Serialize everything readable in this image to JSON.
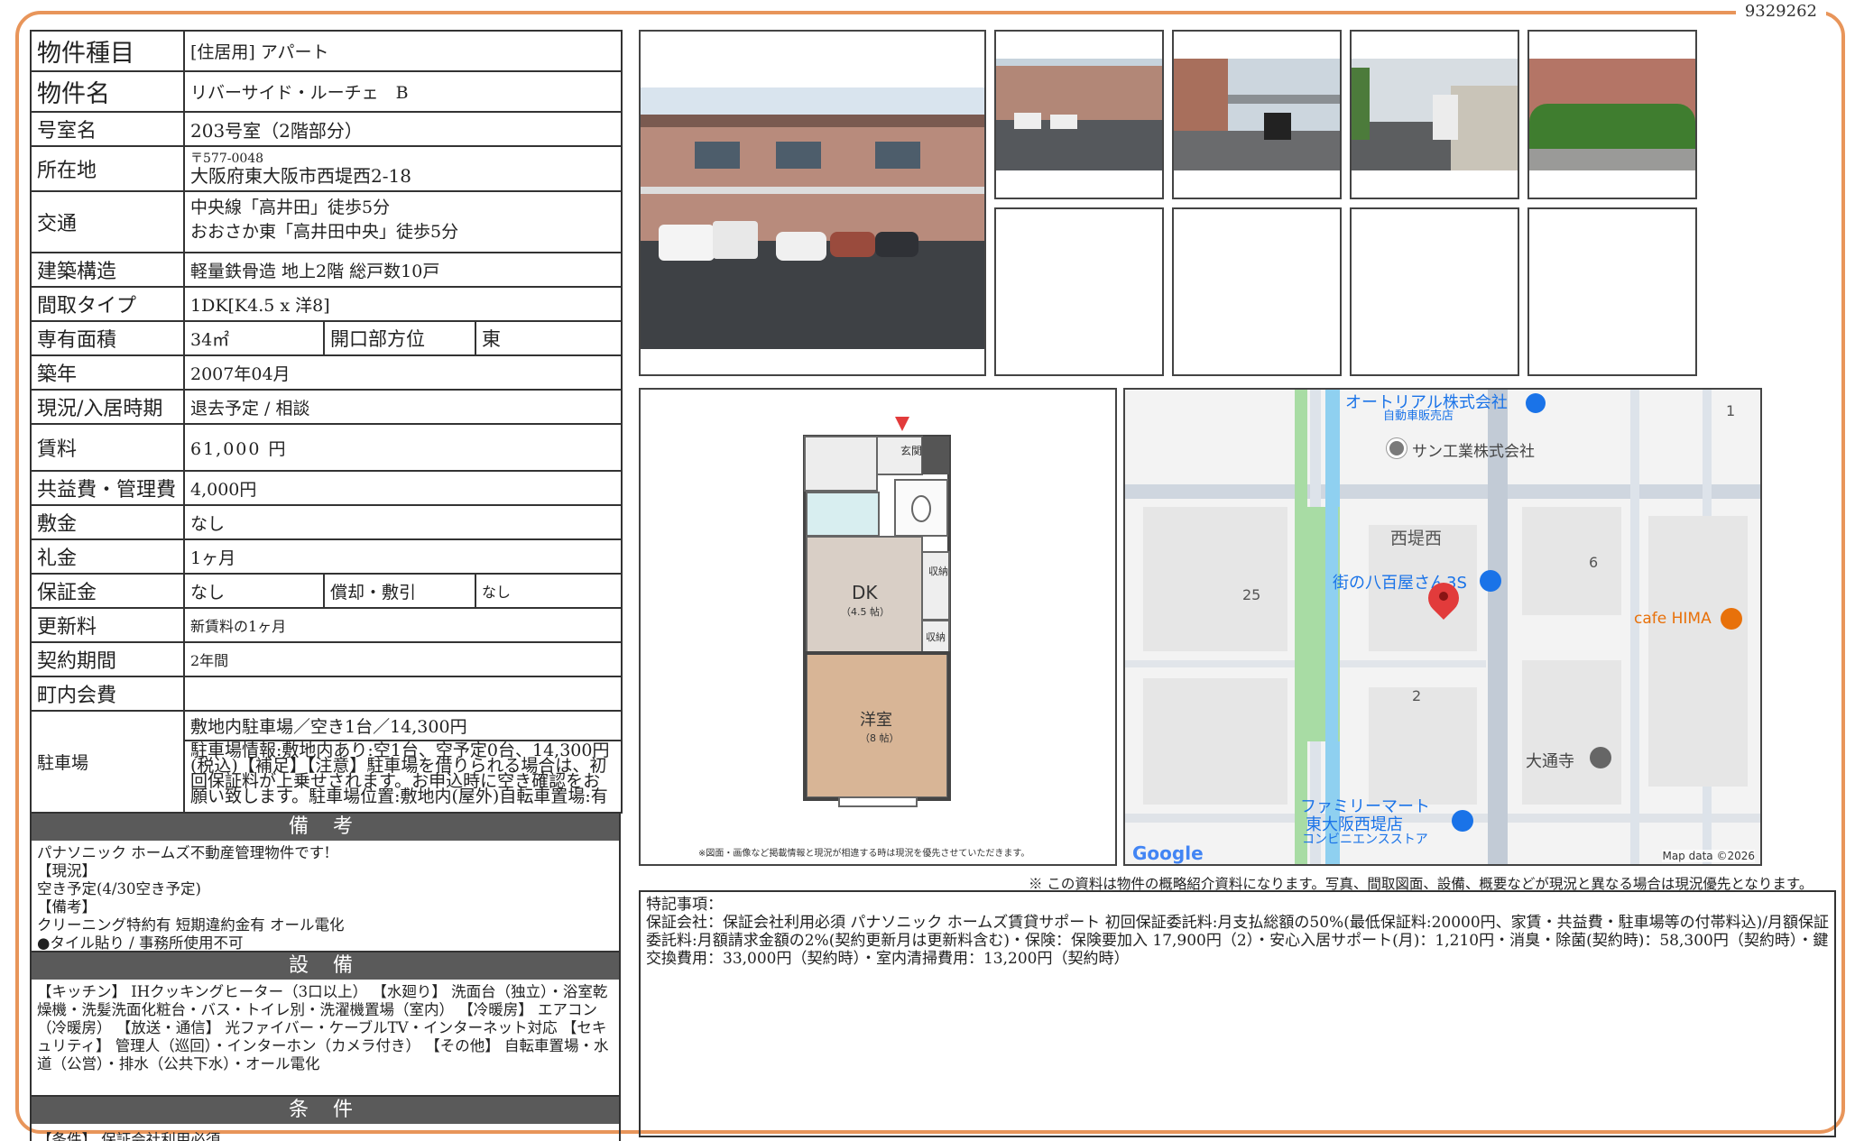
{
  "doc_id": "9329262",
  "spec": {
    "type_label": "物件種目",
    "type_value": "[住居用]  アパート",
    "name_label": "物件名",
    "name_value": "リバーサイド・ルーチェ　B",
    "room_label": "号室名",
    "room_value": "203号室（2階部分）",
    "address_label": "所在地",
    "postal": "〒577-0048",
    "address": "大阪府東大阪市西堤西2-18",
    "transport_label": "交通",
    "transport_1": "中央線「高井田」徒歩5分",
    "transport_2": "おおさか東「高井田中央」徒歩5分",
    "structure_label": "建築構造",
    "structure_value": "軽量鉄骨造  地上2階  総戸数10戸",
    "layout_label": "間取タイプ",
    "layout_value": "1DK[K4.5 x 洋8]",
    "area_label": "専有面積",
    "area_value": "34㎡",
    "opening_label": "開口部方位",
    "opening_value": "東",
    "built_label": "築年",
    "built_value": "2007年04月",
    "status_label": "現況/入居時期",
    "status_value": "退去予定  /  相談",
    "rent_label": "賃料",
    "rent_value": "61,000 円",
    "fee_label": "共益費・管理費",
    "fee_value": "4,000円",
    "deposit_label": "敷金",
    "deposit_value": "なし",
    "key_label": "礼金",
    "key_value": "1ヶ月",
    "guarantee_label": "保証金",
    "guarantee_value": "なし",
    "amort_label": "償却・敷引",
    "amort_value": "なし",
    "renewal_label": "更新料",
    "renewal_value": "新賃料の1ヶ月",
    "contract_label": "契約期間",
    "contract_value": "2年間",
    "town_label": "町内会費",
    "town_value": "",
    "parking_label": "駐車場",
    "parking_value": "敷地内駐車場／空き1台／14,300円",
    "parking_detail": "駐車場情報:敷地内あり:空1台、空予定0台、14,300円(税込)【補足】【注意】駐車場を借りられる場合は、初回保証料が上乗せされます。お申込時に空き確認をお願い致します。駐車場位置:敷地内(屋外)自転車置場:有"
  },
  "remarks": {
    "title": "備 考",
    "lines": [
      "パナソニック ホームズ不動産管理物件です!",
      "【現況】",
      "空き予定(4/30空き予定)",
      "【備考】",
      "クリーニング特約有  短期違約金有  オール電化",
      "●タイル貼り  /  事務所使用不可"
    ]
  },
  "equipment": {
    "title": "設 備",
    "text": "【キッチン】 IHクッキングヒーター（3口以上） 【水廻り】 洗面台（独立）・浴室乾燥機・洗髪洗面化粧台・バス・トイレ別・洗濯機置場（室内） 【冷暖房】 エアコン（冷暖房） 【放送・通信】 光ファイバー・ケーブルTV・インターネット対応 【セキュリティ】 管理人（巡回）・インターホン（カメラ付き） 【その他】 自転車置場・水道（公営）・排水（公共下水）・オール電化"
  },
  "conditions": {
    "title": "条 件",
    "text": "【条件】 保証会社利用必須"
  },
  "floorplan": {
    "genkan": "玄関",
    "dk": "DK",
    "dk_size": "（4.5 帖）",
    "storage": "収納",
    "storage2": "収納",
    "youshitsu": "洋室",
    "yous_size": "（8 帖）",
    "note": "※図面・画像など掲載情報と現況が相違する時は現況を優先させていただきます。"
  },
  "map": {
    "labels": {
      "autorial": "オートリアル株式会社",
      "autorial_sub": "自動車販売店",
      "san": "サン工業株式会社",
      "nishi": "西堤西",
      "yaoya": "街の八百屋さん3S",
      "cafe": "cafe HIMA",
      "daitsuji": "大通寺",
      "famima": "ファミリーマート",
      "famima2": "東大阪西堤店",
      "famima3": "コンビニエンスストア",
      "n1": "1",
      "n25": "25",
      "n6": "6",
      "n2": "2"
    },
    "google": "Google",
    "mapdata": "Map data ©2026"
  },
  "disclaimer": "※ この資料は物件の概略紹介資料になります。写真、間取図面、設備、概要などが現況と異なる場合は現況優先となります。",
  "special": {
    "title": "特記事項：",
    "text": "保証会社：保証会社利用必須  パナソニック ホームズ賃貸サポート  初回保証委託料:月支払総額の50%(最低保証料:20000円、家賃・共益費・駐車場等の付帯料込)/月額保証委託料:月額請求金額の2%(契約更新月は更新料含む)・保険：保険要加入 17,900円（2）・安心入居サポート(月)：1,210円・消臭・除菌(契約時)：58,300円（契約時）・鍵交換費用：33,000円（契約時）・室内清掃費用：13,200円（契約時）"
  },
  "colors": {
    "frame": "#e8955a",
    "section_bar": "#5a5a5a",
    "map_pin": "#e23b3b",
    "map_poi": "#1a73e8",
    "map_cafe": "#e8710a"
  }
}
